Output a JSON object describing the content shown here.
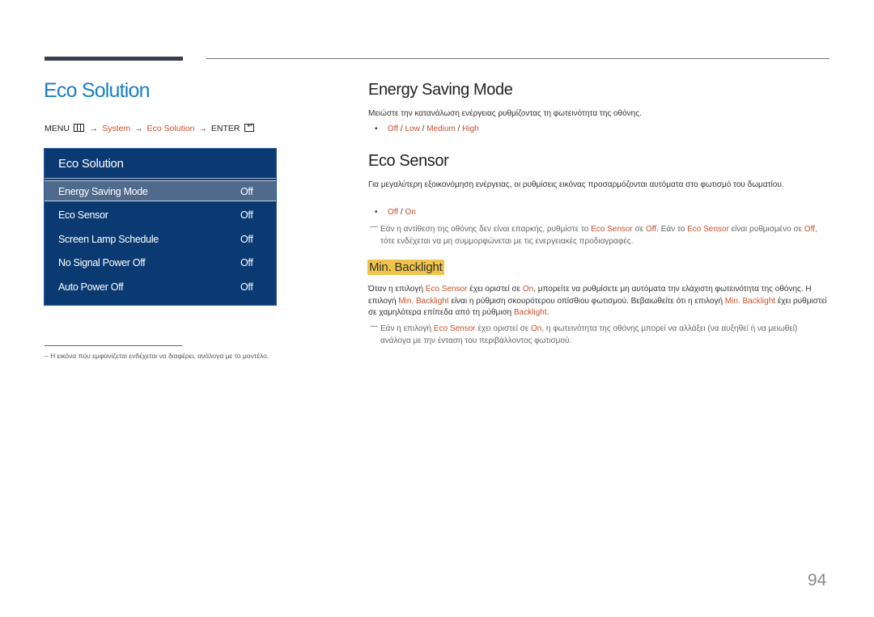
{
  "page_title": "Eco Solution",
  "menu_path": {
    "menu": "MENU",
    "arrow": "→",
    "system": "System",
    "eco_solution": "Eco Solution",
    "enter": "ENTER"
  },
  "osd": {
    "title": "Eco Solution",
    "items": [
      {
        "label": "Energy Saving Mode",
        "value": "Off",
        "selected": true
      },
      {
        "label": "Eco Sensor",
        "value": "Off"
      },
      {
        "label": "Screen Lamp Schedule",
        "value": "Off"
      },
      {
        "label": "No Signal Power Off",
        "value": "Off"
      },
      {
        "label": "Auto Power Off",
        "value": "Off"
      }
    ]
  },
  "footnote": "–  Η εικόνα που εμφανίζεται ενδέχεται να διαφέρει, ανάλογα με το μοντέλο.",
  "energy_saving": {
    "heading": "Energy Saving Mode",
    "description": "Μειώστε την κατανάλωση ενέργειας ρυθμίζοντας τη φωτεινότητα της οθόνης.",
    "options": [
      "Off",
      "Low",
      "Medium",
      "High"
    ],
    "separator": " / "
  },
  "eco_sensor": {
    "heading": "Eco Sensor",
    "description": "Για μεγαλύτερη εξοικονόμηση ενέργειας, οι ρυθμίσεις εικόνας προσαρμόζονται αυτόματα στο φωτισμό του δωματίου.",
    "options": [
      "Off",
      "On"
    ],
    "note": {
      "p1": "Εάν η αντίθεση της οθόνης δεν είναι επαρκής, ρυθμίστε το ",
      "eco_sensor": "Eco Sensor",
      "p2": " σε ",
      "off": "Off",
      "p3": ". Εάν το ",
      "p4": " είναι ρυθμισμένο σε ",
      "p5": ", τότε ενδέχεται να μη συμμορφώνεται με τις ενεργειακές προδιαγραφές."
    }
  },
  "min_backlight": {
    "heading": "Min. Backlight",
    "text": {
      "p1": "Όταν η επιλογή ",
      "eco_sensor": "Eco Sensor",
      "p2": " έχει οριστεί σε ",
      "on": "On",
      "p3": ", μπορείτε να ρυθμίσετε μη αυτόματα την ελάχιστη φωτεινότητα της οθόνης. Η επιλογή ",
      "min_backlight": "Min. Backlight",
      "p4": " είναι η ρύθμιση σκουρότερου οπίσθιου φωτισμού. Βεβαιωθείτε ότι η επιλογή ",
      "p5": " έχει ρυθμιστεί σε χαμηλότερα επίπεδα από τη ρύθμιση ",
      "backlight": "Backlight",
      "p6": "."
    },
    "note": {
      "p1": "Εάν η επιλογή ",
      "eco_sensor": "Eco Sensor",
      "p2": " έχει οριστεί σε ",
      "on": "On",
      "p3": ", η φωτεινότητα της οθόνης μπορεί να αλλάξει (να αυξηθεί ή να μειωθεί) ανάλογα με την ένταση του περιβάλλοντος φωτισμού."
    }
  },
  "note_dash": "—",
  "bullet": "•",
  "page_number": "94",
  "colors": {
    "title_blue": "#1a7fc1",
    "highlight_orange": "#c94f2a",
    "osd_background": "#0b3a73",
    "osd_selected": "#4f6a8c",
    "heading_highlight": "#f0c44a"
  }
}
